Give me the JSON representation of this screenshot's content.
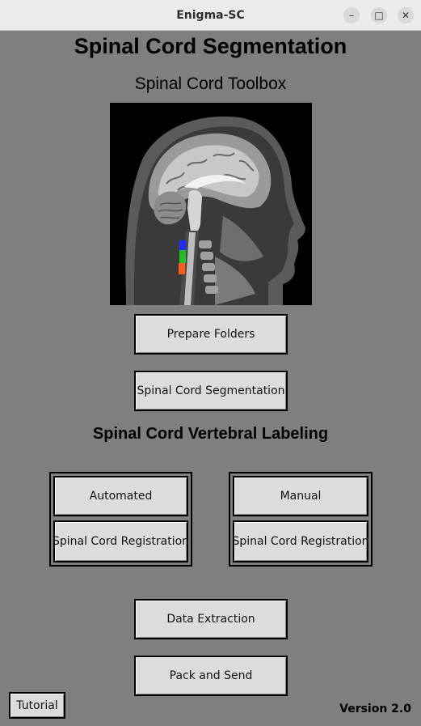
{
  "window": {
    "title": "Enigma-SC",
    "controls": [
      "minimize-icon",
      "maximize-icon",
      "close-icon"
    ]
  },
  "header": {
    "title": "Spinal Cord Segmentation",
    "subtitle": "Spinal Cord Toolbox"
  },
  "buttons": {
    "prepare": "Prepare Folders",
    "segmentation": "Spinal Cord Segmentation",
    "data_extraction": "Data Extraction",
    "pack_send": "Pack and Send",
    "tutorial": "Tutorial"
  },
  "labeling": {
    "title": "Spinal Cord Vertebral Labeling",
    "automated": {
      "label": "Automated",
      "registration": "Spinal Cord Registration"
    },
    "manual": {
      "label": "Manual",
      "registration": "Spinal Cord Registration"
    }
  },
  "footer": {
    "version": "Version 2.0"
  },
  "colors": {
    "background": "#7f7f7f",
    "button": "#dcdcdc",
    "seg_blue": "#1f2cff",
    "seg_green": "#20c020",
    "seg_orange": "#ff5a1a"
  }
}
